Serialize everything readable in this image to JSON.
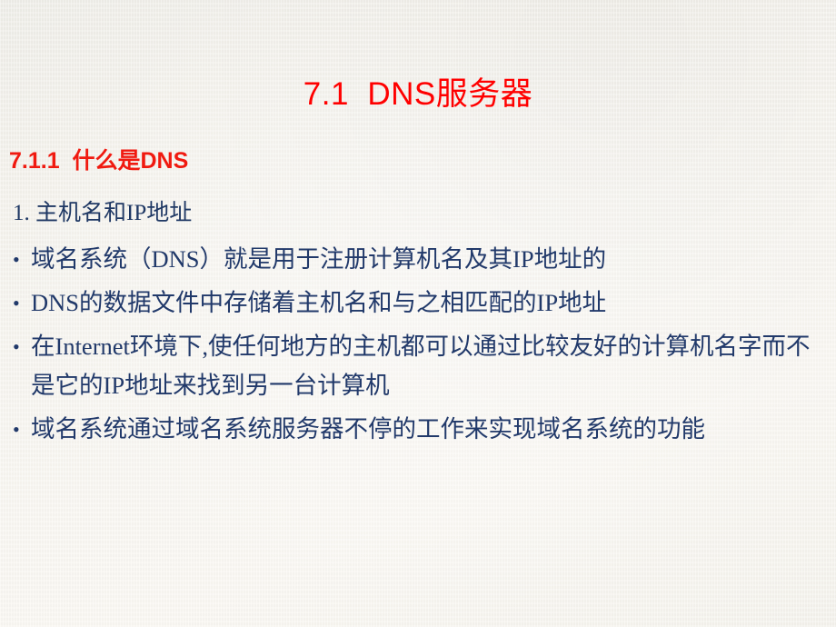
{
  "slide": {
    "title": "7.1  DNS服务器",
    "section_heading": "7.1.1  什么是DNS",
    "numbered_item": "1. 主机名和IP地址",
    "bullet_marker": "•",
    "bullets": [
      {
        "text": "域名系统（DNS）就是用于注册计算机名及其IP地址的"
      },
      {
        "text": "DNS的数据文件中存储着主机名和与之相匹配的IP地址"
      },
      {
        "text": "在Internet环境下,使任何地方的主机都可以通过比较友好的计算机名字而不是它的IP地址来找到另一台计算机"
      },
      {
        "text": "域名系统通过域名系统服务器不停的工作来实现域名系统的功能"
      }
    ]
  },
  "colors": {
    "background": "#f6f4ef",
    "title_red": "#ff0000",
    "heading_red": "#f01a10",
    "body_navy": "#1f3864",
    "bullet_navy": "#21396a"
  }
}
